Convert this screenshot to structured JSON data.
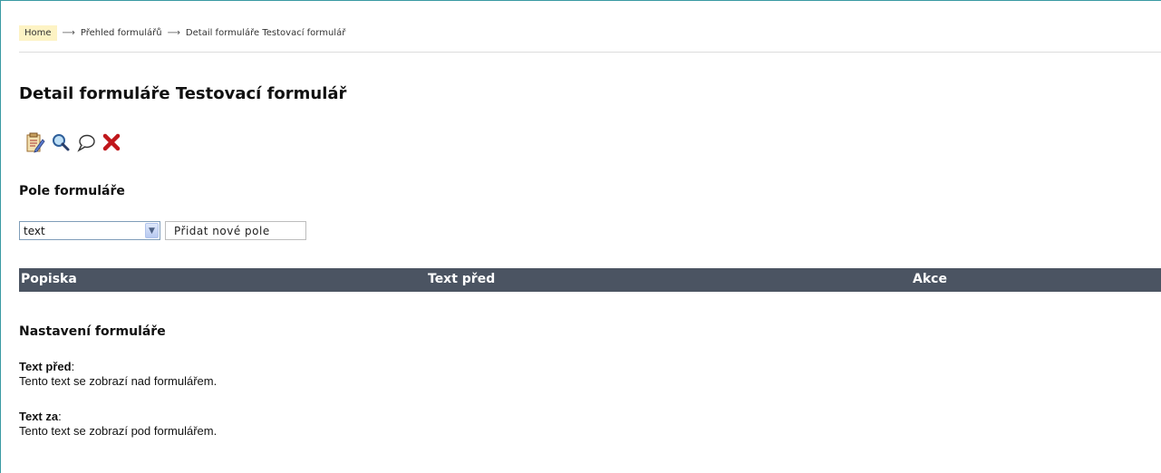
{
  "breadcrumb": {
    "home": "Home",
    "separator": "⟶",
    "items": [
      "Přehled formulářů",
      "Detail formuláře Testovací formulář"
    ]
  },
  "page_title": "Detail formuláře Testovací formulář",
  "toolbar": {
    "icons": [
      "edit-icon",
      "search-icon",
      "comment-icon",
      "delete-icon"
    ]
  },
  "fields_section": {
    "heading": "Pole formuláře",
    "select_value": "text",
    "add_button": "Přidat nové pole"
  },
  "table": {
    "columns": [
      "Popiska",
      "Text před",
      "Akce"
    ]
  },
  "settings_section": {
    "heading": "Nastavení formuláře",
    "text_before_label": "Text před",
    "text_before_value": "Tento text se zobrazí nad formulářem.",
    "text_after_label": "Text za",
    "text_after_value": "Tento text se zobrazí pod formulářem."
  },
  "colors": {
    "table_header": "#4b5462",
    "home_highlight": "#fdf3c4",
    "frame_border": "#3a9aa3"
  }
}
